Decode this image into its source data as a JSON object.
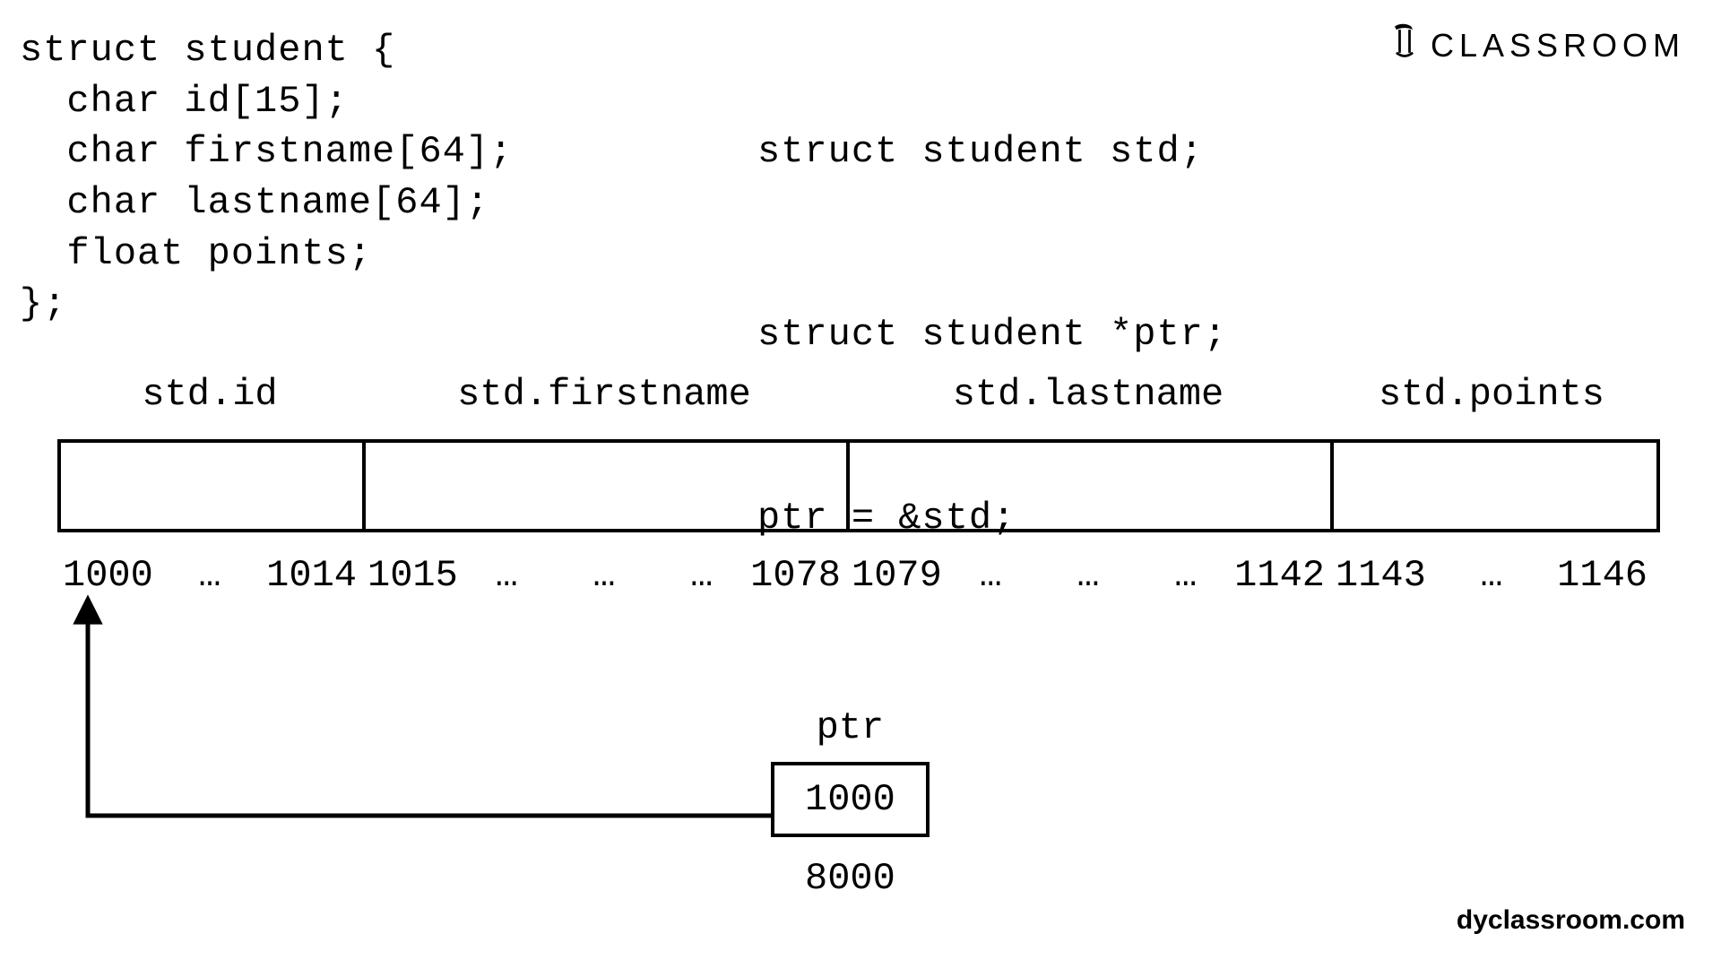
{
  "brand": "CLASSROOM",
  "footer": "dyclassroom.com",
  "code_left": "struct student {\n  char id[15];\n  char firstname[64];\n  char lastname[64];\n  float points;\n};",
  "code_right": {
    "l1": "struct student std;",
    "l2": "struct student *ptr;",
    "l3": "ptr = &std;"
  },
  "fields": {
    "id": {
      "label": "std.id",
      "start": "1000",
      "end": "1014",
      "mids": 1
    },
    "firstname": {
      "label": "std.firstname",
      "start": "1015",
      "end": "1078",
      "mids": 3
    },
    "lastname": {
      "label": "std.lastname",
      "start": "1079",
      "end": "1142",
      "mids": 3
    },
    "points": {
      "label": "std.points",
      "start": "1143",
      "end": "1146",
      "mids": 1
    }
  },
  "ellipsis": "…",
  "pointer": {
    "name": "ptr",
    "value": "1000",
    "address": "8000"
  }
}
